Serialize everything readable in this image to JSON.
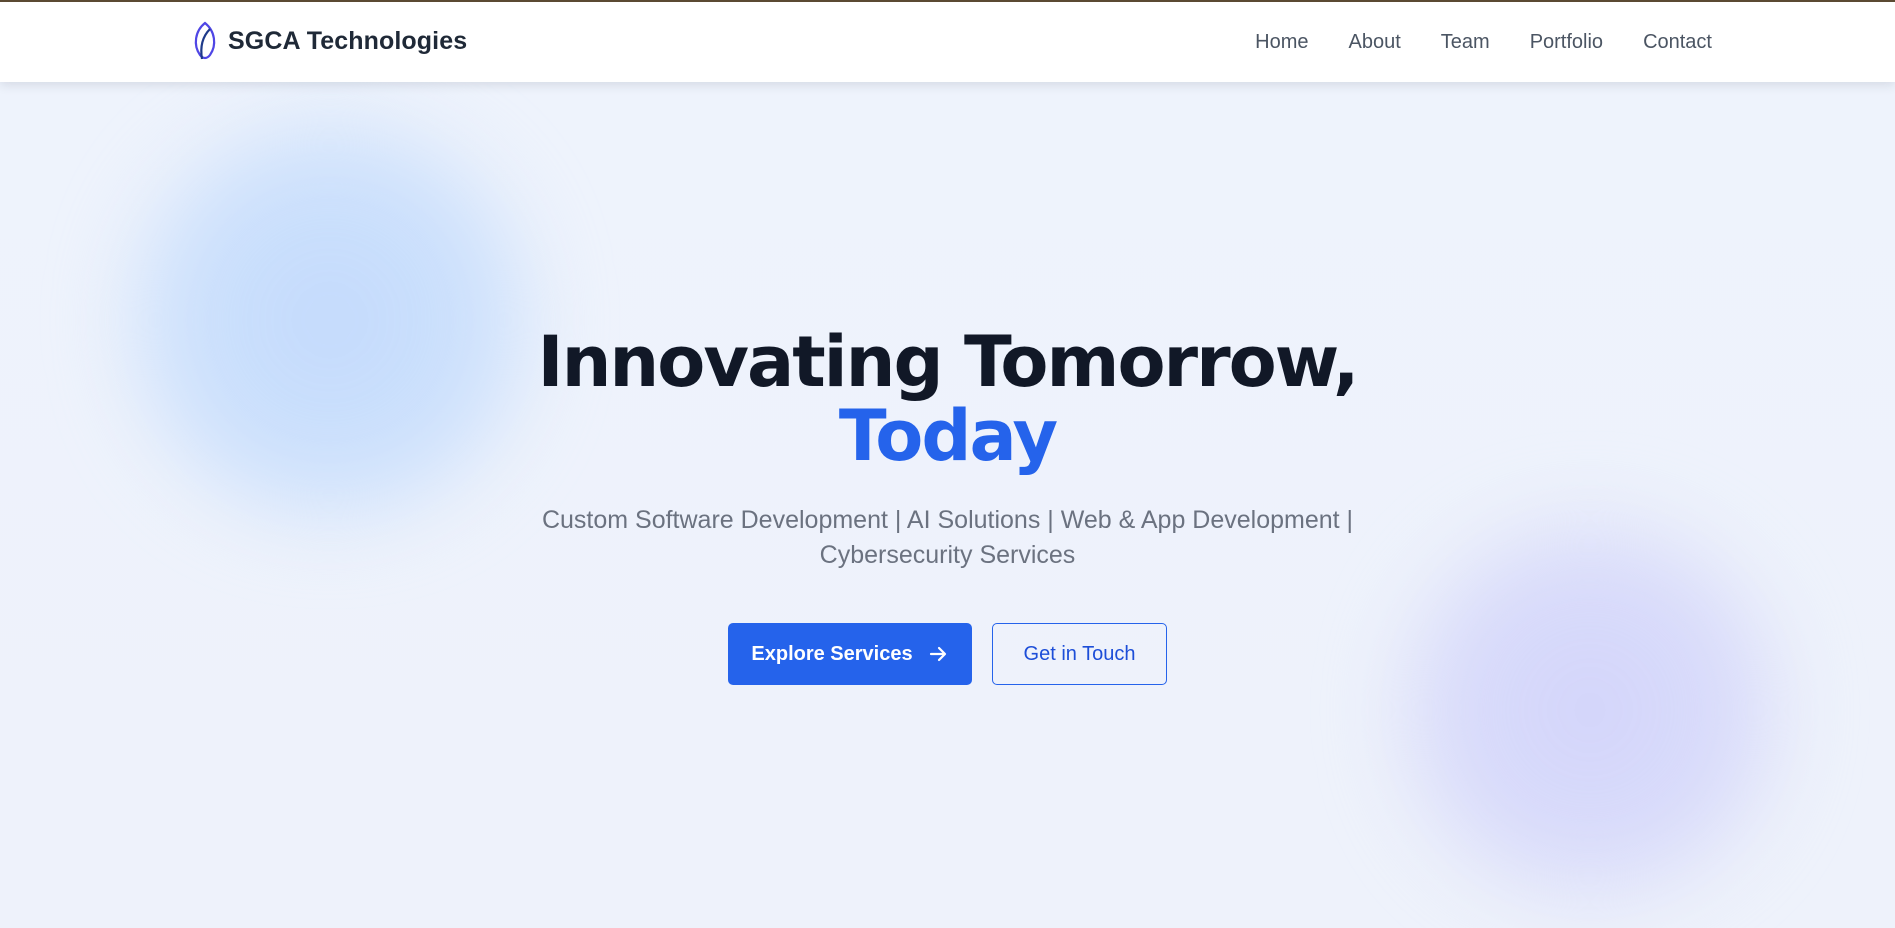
{
  "brand": {
    "name": "SGCA Technologies",
    "logo_icon": "leaf-outline-icon"
  },
  "nav": {
    "items": [
      {
        "label": "Home"
      },
      {
        "label": "About"
      },
      {
        "label": "Team"
      },
      {
        "label": "Portfolio"
      },
      {
        "label": "Contact"
      }
    ]
  },
  "hero": {
    "title_line1": "Innovating Tomorrow,",
    "title_accent": "Today",
    "subtitle": "Custom Software Development | AI Solutions | Web & App Development | Cybersecurity Services",
    "primary_button": {
      "label": "Explore Services",
      "icon": "arrow-right-icon"
    },
    "secondary_button": {
      "label": "Get in Touch"
    }
  },
  "colors": {
    "accent": "#2563eb",
    "heading": "#111827",
    "muted_text": "#6b7280",
    "nav_text": "#4b5563",
    "background": "#eef3fc"
  }
}
